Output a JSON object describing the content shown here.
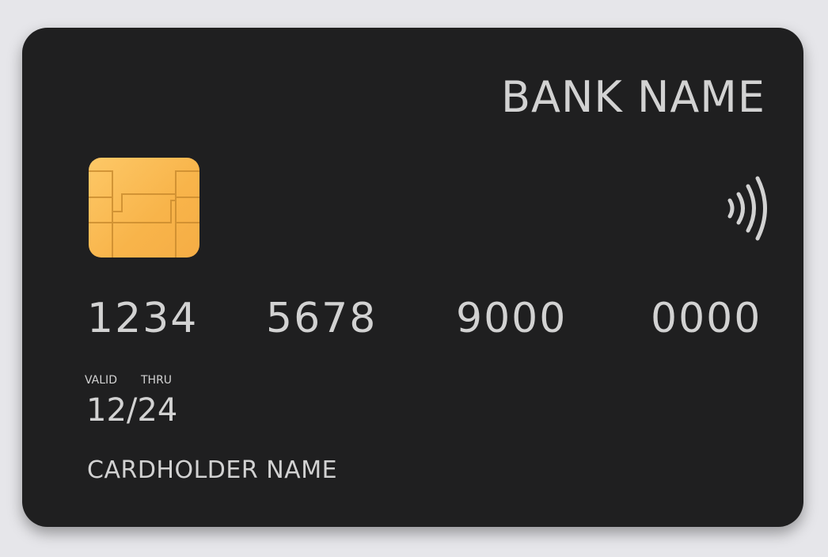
{
  "card": {
    "bank_name": "BANK NAME",
    "number_groups": [
      "1234",
      "5678",
      "9000",
      "0000"
    ],
    "valid_label": "VALID",
    "thru_label": "THRU",
    "expiry": "12/24",
    "cardholder": "CARDHOLDER NAME",
    "icons": [
      "chip-icon",
      "contactless-icon"
    ],
    "colors": {
      "card": "#1f1f20",
      "background": "#e6e6ea",
      "chip": "#f8b44a",
      "text": "#d2d2d2"
    }
  }
}
